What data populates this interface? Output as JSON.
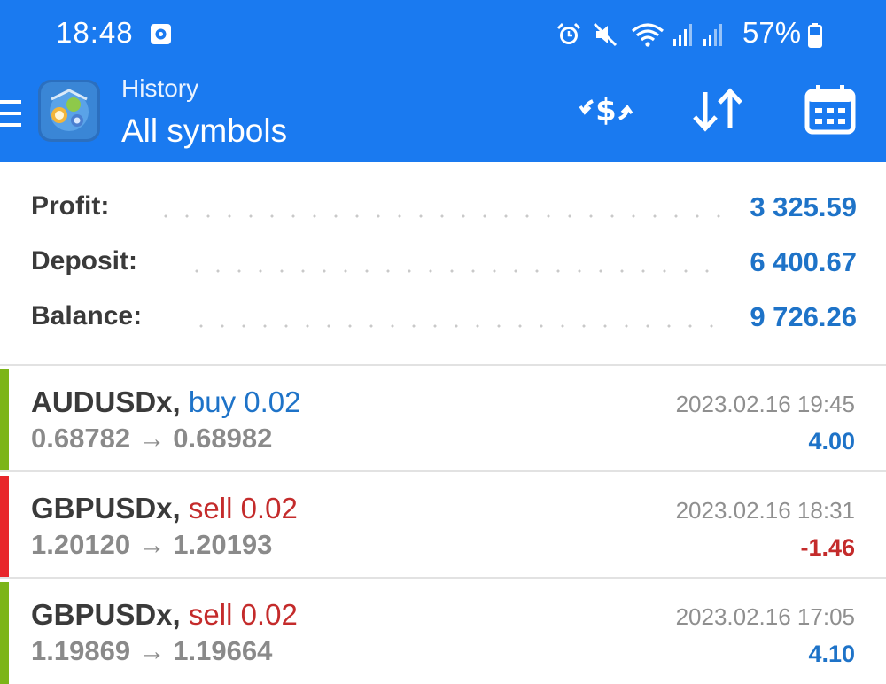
{
  "status_bar": {
    "time": "18:48",
    "battery": "57%",
    "icons": [
      "app-notification-icon",
      "alarm-icon",
      "mute-icon",
      "wifi-icon",
      "signal-icon",
      "signal-icon",
      "battery-icon"
    ]
  },
  "toolbar": {
    "subtitle": "History",
    "title": "All symbols",
    "buttons": [
      "currency-exchange-icon",
      "sort-icon",
      "calendar-icon"
    ]
  },
  "summary": {
    "profit_label": "Profit:",
    "profit_value": "3 325.59",
    "deposit_label": "Deposit:",
    "deposit_value": "6 400.67",
    "balance_label": "Balance:",
    "balance_value": "9 726.26"
  },
  "deals": [
    {
      "symbol": "AUDUSDx,",
      "type": "buy 0.02",
      "prices": "0.68782 → 0.68982",
      "time": "2023.02.16 19:45",
      "profit": "4.00"
    },
    {
      "symbol": "GBPUSDx,",
      "type": "sell 0.02",
      "prices": "1.20120 → 1.20193",
      "time": "2023.02.16 18:31",
      "profit": "-1.46"
    },
    {
      "symbol": "GBPUSDx,",
      "type": "sell 0.02",
      "prices": "1.19869 → 1.19664",
      "time": "2023.02.16 17:05",
      "profit": "4.10"
    }
  ],
  "colors": {
    "header": "#1a7af0",
    "positive": "#1e73c8",
    "negative": "#c42b2b",
    "profit_bar": "#7cb518",
    "loss_bar": "#e8262a"
  }
}
